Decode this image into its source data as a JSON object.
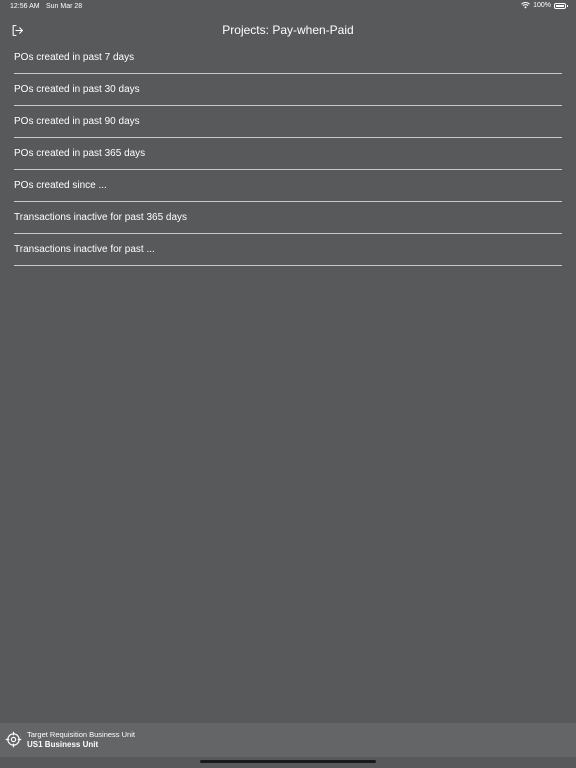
{
  "status_bar": {
    "time": "12:56 AM",
    "date": "Sun Mar 28",
    "battery": "100%",
    "battery_level": 1.0
  },
  "nav": {
    "title": "Projects: Pay-when-Paid",
    "left_icon": "logout-icon"
  },
  "menu": {
    "items": [
      {
        "label": "POs created in past 7 days"
      },
      {
        "label": "POs created in past 30 days"
      },
      {
        "label": "POs created in past 90 days"
      },
      {
        "label": "POs created in past 365 days"
      },
      {
        "label": "POs created since ..."
      },
      {
        "label": "Transactions inactive for past 365 days"
      },
      {
        "label": "Transactions inactive for past ..."
      }
    ]
  },
  "footer": {
    "icon": "target-icon",
    "label": "Target Requisition Business Unit",
    "value": "US1 Business Unit"
  },
  "colors": {
    "background": "#58595b",
    "footer_background": "#646567",
    "divider": "#c9c9cb",
    "text": "#ffffff"
  }
}
